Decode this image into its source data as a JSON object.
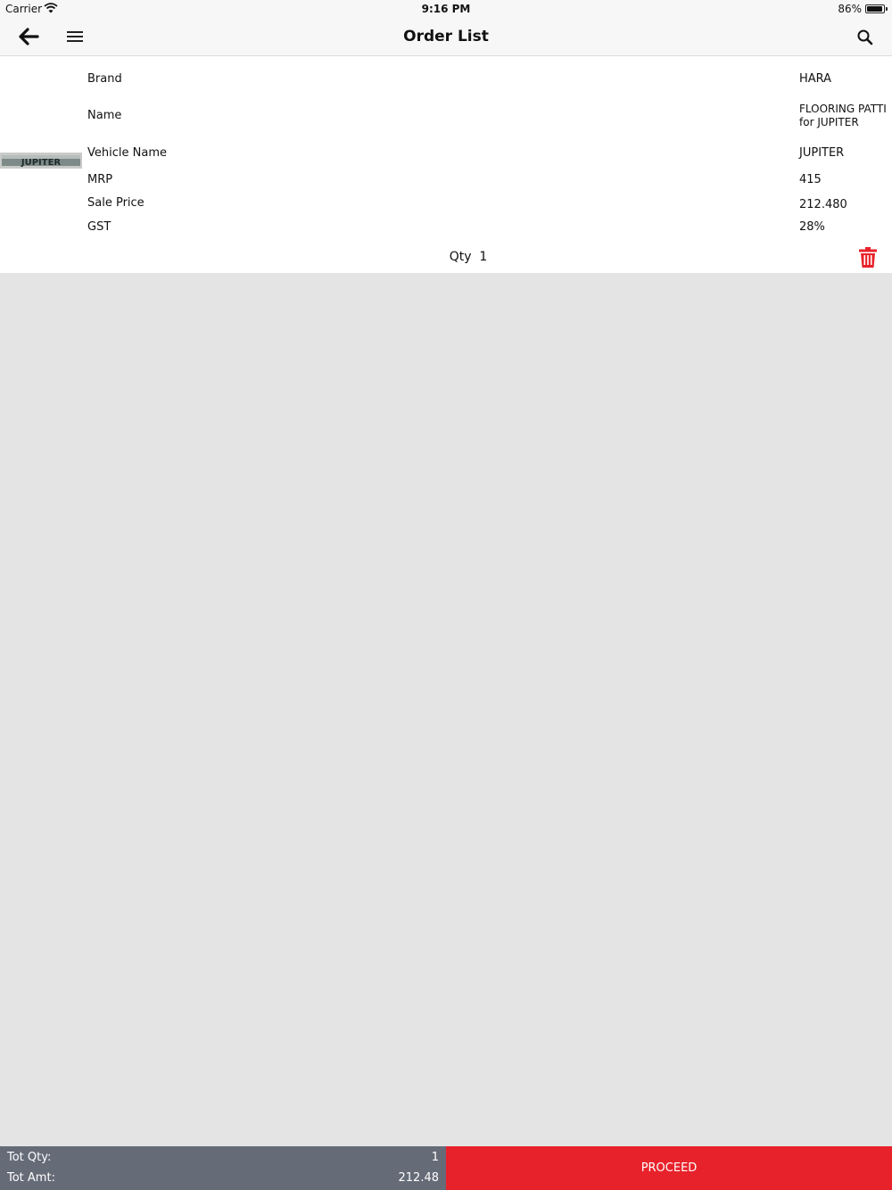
{
  "status_bar": {
    "carrier": "Carrier",
    "time": "9:16 PM",
    "battery": "86%",
    "battery_level": 0.86
  },
  "nav": {
    "title": "Order List"
  },
  "order": {
    "fields": [
      {
        "label": "Brand",
        "value": "HARA"
      },
      {
        "label": "Name",
        "value": "FLOORING PATTI for JUPITER"
      },
      {
        "label": "Vehicle Name",
        "value": "JUPITER"
      },
      {
        "label": "MRP",
        "value": "415"
      },
      {
        "label": "Sale Price",
        "value": "212.480"
      },
      {
        "label": "GST",
        "value": "28%"
      }
    ],
    "qty_label": "Qty",
    "qty": "1",
    "image_text": "JUPITER"
  },
  "footer": {
    "tot_qty_label": "Tot Qty:",
    "tot_qty": "1",
    "tot_amt_label": "Tot Amt:",
    "tot_amt": "212.48",
    "proceed": "PROCEED"
  },
  "colors": {
    "accent": "#e8222b",
    "totals_bg": "#666b78",
    "background": "#e4e4e4"
  }
}
